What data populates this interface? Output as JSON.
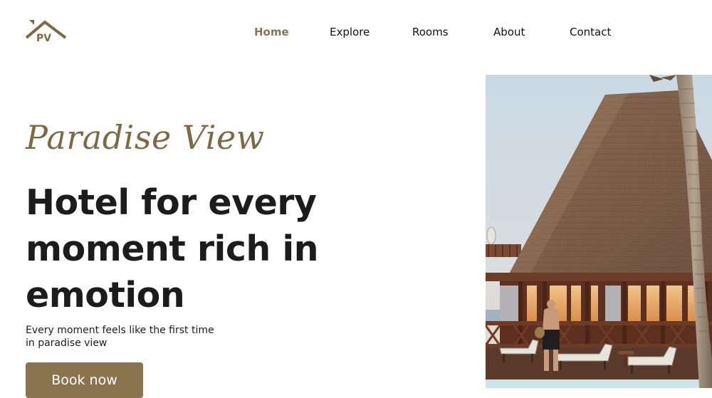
{
  "brand": {
    "logo_text": "PV",
    "logo_color": "#7d6a45"
  },
  "nav": {
    "items": [
      {
        "label": "Home",
        "active": true
      },
      {
        "label": "Explore",
        "active": false
      },
      {
        "label": "Rooms",
        "active": false
      },
      {
        "label": "About",
        "active": false
      },
      {
        "label": "Contact",
        "active": false
      }
    ]
  },
  "hero": {
    "script_title": "Paradise View",
    "headline": "Hotel for every moment rich in emotion",
    "subtitle": "Every moment feels like the first time in paradise view",
    "cta_label": "Book now",
    "image_alt": "Resort building with thatched pyramid roof and poolside loungers under a palm tree"
  },
  "colors": {
    "accent": "#8a7450",
    "script": "#7d6a45",
    "text": "#1c1c1c",
    "background": "#ffffff"
  }
}
